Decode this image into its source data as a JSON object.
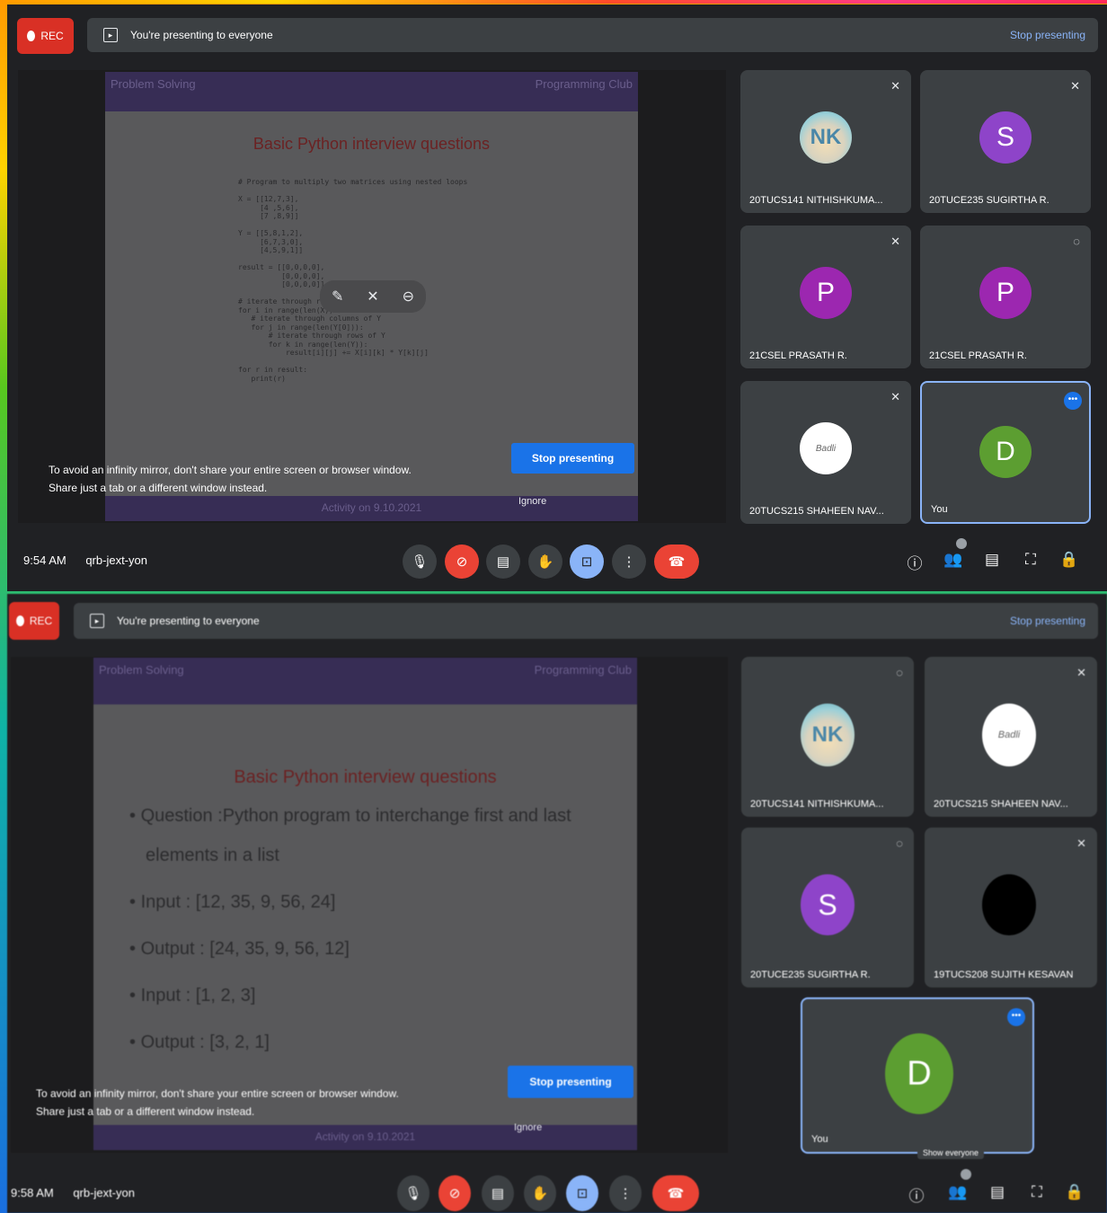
{
  "top": {
    "rec_label": "REC",
    "banner_text": "You're presenting to everyone",
    "stop_presenting_link": "Stop presenting",
    "slide": {
      "header_left": "Problem Solving",
      "header_right": "Programming Club",
      "title": "Basic Python interview questions",
      "code_lines": "# Program to multiply two matrices using nested loops\n\nX = [[12,7,3],\n     [4 ,5,6],\n     [7 ,8,9]]\n\nY = [[5,8,1,2],\n     [6,7,3,0],\n     [4,5,9,1]]\n\nresult = [[0,0,0,0],\n          [0,0,0,0],\n          [0,0,0,0]]\n\n# iterate through rows of X\nfor i in range(len(X)):\n   # iterate through columns of Y\n   for j in range(len(Y[0])):\n       # iterate through rows of Y\n       for k in range(len(Y)):\n           result[i][j] += X[i][k] * Y[k][j]\n\nfor r in result:\n   print(r)",
      "footer": "Activity on 9.10.2021"
    },
    "float_icons": [
      "pin-icon",
      "mute-icon",
      "minimize-icon"
    ],
    "warning_line1": "To avoid an infinity mirror, don't share your entire screen or browser window.",
    "warning_line2": "Share just a tab or a different window instead.",
    "stop_button": "Stop presenting",
    "ignore": "Ignore",
    "participants": [
      {
        "name": "20TUCS141 NITHISHKUMA...",
        "avatar": "NK",
        "avatar_type": "image",
        "mic": "muted"
      },
      {
        "name": "20TUCE235 SUGIRTHA R.",
        "avatar": "S",
        "avatar_color": "#8e44c9",
        "mic": "muted"
      },
      {
        "name": "21CSEL PRASATH R.",
        "avatar": "P",
        "avatar_color": "#9c27b0",
        "mic": "muted"
      },
      {
        "name": "21CSEL PRASATH R.",
        "avatar": "P",
        "avatar_color": "#9c27b0",
        "mic": "speaking"
      },
      {
        "name": "20TUCS215 SHAHEEN NAV...",
        "avatar": "Badli",
        "avatar_type": "logo",
        "mic": "muted"
      },
      {
        "name": "You",
        "avatar": "D",
        "avatar_color": "#5c9e31",
        "mic": "more"
      }
    ],
    "time": "9:54 AM",
    "meeting_code": "qrb-jext-yon",
    "right_icons": [
      "info-icon",
      "people-icon",
      "chat-icon",
      "activities-icon",
      "lock-icon"
    ]
  },
  "bottom": {
    "rec_label": "REC",
    "banner_text": "You're presenting to everyone",
    "stop_presenting_link": "Stop presenting",
    "slide": {
      "header_left": "Problem Solving",
      "header_right": "Programming Club",
      "title": "Basic Python interview questions",
      "bullets": [
        "Question :Python program to interchange first and last",
        "elements in a list",
        "Input : [12, 35, 9, 56, 24]",
        "Output : [24, 35, 9, 56, 12]",
        "Input : [1, 2, 3]",
        "Output : [3, 2, 1]"
      ],
      "footer": "Activity on 9.10.2021"
    },
    "warning_line1": "To avoid an infinity mirror, don't share your entire screen or browser window.",
    "warning_line2": "Share just a tab or a different window instead.",
    "stop_button": "Stop presenting",
    "ignore": "Ignore",
    "participants": [
      {
        "name": "20TUCS141 NITHISHKUMA...",
        "avatar": "NK",
        "avatar_type": "image"
      },
      {
        "name": "20TUCS215 SHAHEEN NAV...",
        "avatar": "Badli",
        "avatar_type": "logo"
      },
      {
        "name": "20TUCE235 SUGIRTHA R.",
        "avatar": "S",
        "avatar_color": "#8e44c9"
      },
      {
        "name": "19TUCS208 SUJITH KESAVAN",
        "avatar": "",
        "avatar_color": "#000000"
      },
      {
        "name": "You",
        "avatar": "D",
        "avatar_color": "#5c9e31"
      }
    ],
    "tooltip": "Show everyone",
    "time": "9:58 AM",
    "meeting_code": "qrb-jext-yon",
    "right_icons": [
      "info-icon",
      "people-icon",
      "chat-icon",
      "activities-icon",
      "lock-icon"
    ]
  }
}
